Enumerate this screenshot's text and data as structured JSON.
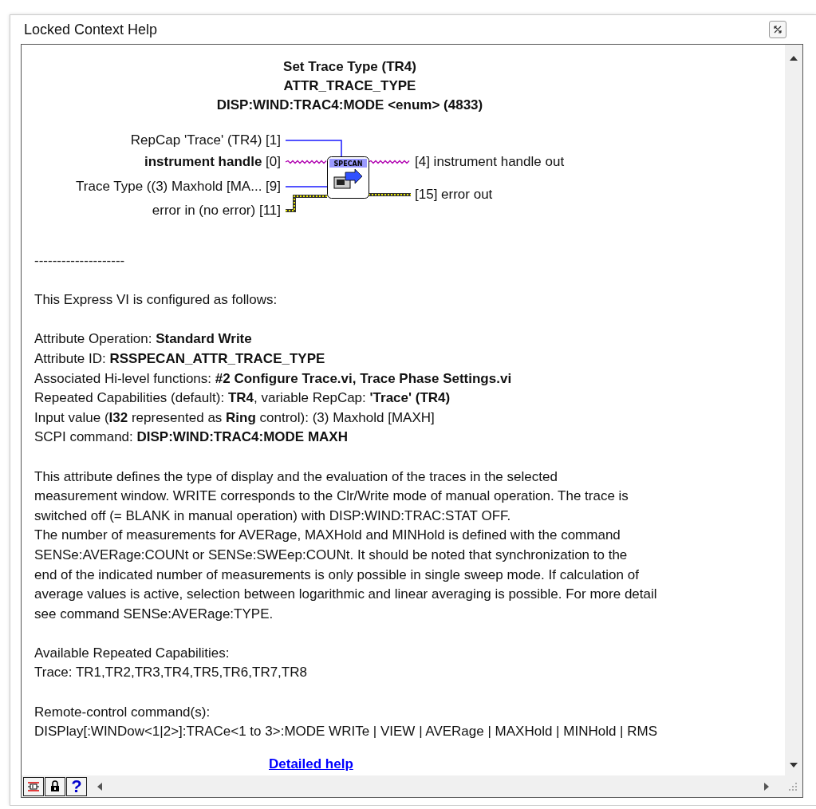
{
  "window": {
    "title": "Locked Context Help"
  },
  "headings": [
    "Set Trace Type (TR4)",
    "ATTR_TRACE_TYPE",
    "DISP:WIND:TRAC4:MODE <enum> (4833)"
  ],
  "diagram": {
    "node_label": "SPECAN",
    "inputs": [
      {
        "label": "RepCap 'Trace' (TR4) [1]",
        "kind": "numeric"
      },
      {
        "label": "**instrument handle** [0]",
        "kind": "refnum"
      },
      {
        "label": "Trace Type ((3) Maxhold [MA... [9]",
        "kind": "numeric"
      },
      {
        "label": "error in (no error) [11]",
        "kind": "error"
      }
    ],
    "outputs": [
      {
        "label": "[4] instrument handle out",
        "kind": "refnum"
      },
      {
        "label": "[15] error out",
        "kind": "error"
      }
    ]
  },
  "blocks": [
    [
      "--------------------"
    ],
    [
      "This Express VI is configured as follows:"
    ],
    [
      "Attribute Operation: **Standard Write**",
      "Attribute ID: **RSSPECAN_ATTR_TRACE_TYPE**",
      "Associated Hi-level functions: **#2 Configure Trace.vi, Trace Phase Settings.vi**",
      "Repeated Capabilities (default): **TR4**, variable RepCap: **'Trace' (TR4)**",
      "Input value (**I32** represented as **Ring** control): (3) Maxhold [MAXH]",
      "SCPI command: **DISP:WIND:TRAC4:MODE MAXH**"
    ],
    [
      "This attribute defines the type of display and the evaluation of the traces in the selected",
      "measurement window. WRITE corresponds to the Clr/Write mode of manual operation. The trace is",
      "switched off (= BLANK in manual operation) with DISP:WIND:TRAC:STAT OFF.",
      "The number of measurements for AVERage, MAXHold and MINHold is defined with the command",
      "SENSe:AVERage:COUNt or SENSe:SWEep:COUNt. It should be noted that synchronization to the",
      "end of the indicated number of measurements is only possible in single sweep mode. If calculation of",
      "average values is active, selection between logarithmic and linear averaging is possible. For more detail",
      "see command SENSe:AVERage:TYPE."
    ],
    [
      "Available Repeated Capabilities:",
      "Trace: TR1,TR2,TR3,TR4,TR5,TR6,TR7,TR8"
    ],
    [
      "Remote-control command(s):",
      "DISPlay[:WINDow<1|2>]:TRACe<1 to 3>:MODE WRITe | VIEW | AVERage | MAXHold | MINHold | RMS"
    ]
  ],
  "link": "Detailed help",
  "toolbar_help_label": "?"
}
